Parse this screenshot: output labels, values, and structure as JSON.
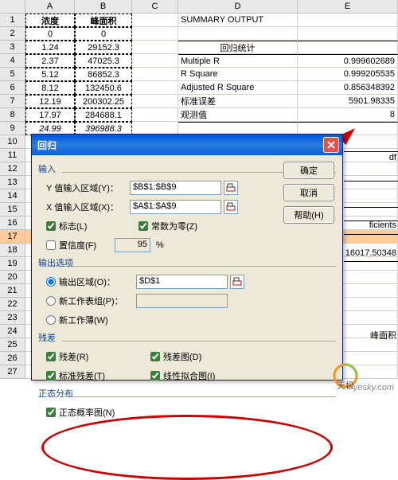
{
  "headers": {
    "a": "A",
    "b": "B",
    "c": "C",
    "d": "D",
    "e": "E"
  },
  "col_titles": {
    "a": "浓度",
    "b": "峰面积"
  },
  "ab": [
    {
      "a": "0",
      "b": "0"
    },
    {
      "a": "1.24",
      "b": "29152.3"
    },
    {
      "a": "2.37",
      "b": "47025.3"
    },
    {
      "a": "5.12",
      "b": "86852.3"
    },
    {
      "a": "8.12",
      "b": "132450.6"
    },
    {
      "a": "12.19",
      "b": "200302.25"
    },
    {
      "a": "17.97",
      "b": "284688.1"
    },
    {
      "a": "24.99",
      "b": "396988.3"
    }
  ],
  "summary_title": "SUMMARY OUTPUT",
  "regstat_title": "回归统计",
  "stats": [
    {
      "k": "Multiple R",
      "v": "0.999602689"
    },
    {
      "k": "R Square",
      "v": "0.999205535"
    },
    {
      "k": "Adjusted R Square",
      "v": "0.856348392"
    },
    {
      "k": "标准误差",
      "v": "5901.98335"
    },
    {
      "k": "观测值",
      "v": "8"
    }
  ],
  "extra": {
    "df": "df",
    "fic": "ficients",
    "val": "16017.50348",
    "fmj": "峰面积"
  },
  "dialog": {
    "title": "回归",
    "input": "输入",
    "y_label": "Y 值输入区域(Y)：",
    "x_label": "X 值输入区域(X)：",
    "y_val": "$B$1:$B$9",
    "x_val": "$A$1:$A$9",
    "label_cb": "标志(L)",
    "zero_cb": "常数为零(Z)",
    "conf_cb": "置信度(F)",
    "conf_val": "95",
    "pct": "%",
    "output": "输出选项",
    "out_range": "输出区域(O)：",
    "out_val": "$D$1",
    "new_sheet": "新工作表组(P)：",
    "new_book": "新工作薄(W)",
    "residual": "残差",
    "res_cb": "残差(R)",
    "stdres_cb": "标准残差(T)",
    "resplot_cb": "残差图(D)",
    "fitplot_cb": "线性拟合图(I)",
    "normal": "正态分布",
    "normplot_cb": "正态概率图(N)",
    "ok": "确定",
    "cancel": "取消",
    "help": "帮助(H)"
  },
  "watermark": "yesky.com"
}
